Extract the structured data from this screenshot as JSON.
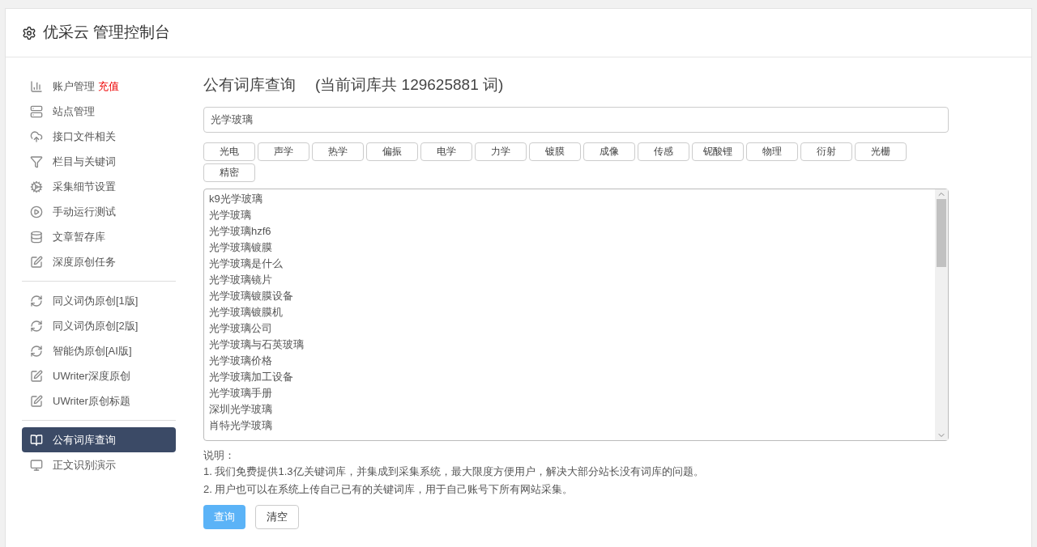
{
  "header": {
    "title": "优采云 管理控制台"
  },
  "sidebar": {
    "groups": [
      [
        {
          "label": "账户管理",
          "badge": "充值",
          "selected": false
        },
        {
          "label": "站点管理",
          "selected": false
        },
        {
          "label": "接口文件相关",
          "selected": false
        },
        {
          "label": "栏目与关键词",
          "selected": false
        },
        {
          "label": "采集细节设置",
          "selected": false
        },
        {
          "label": "手动运行测试",
          "selected": false
        },
        {
          "label": "文章暂存库",
          "selected": false
        },
        {
          "label": "深度原创任务",
          "selected": false
        }
      ],
      [
        {
          "label": "同义词伪原创[1版]",
          "selected": false
        },
        {
          "label": "同义词伪原创[2版]",
          "selected": false
        },
        {
          "label": "智能伪原创[AI版]",
          "selected": false
        },
        {
          "label": "UWriter深度原创",
          "selected": false
        },
        {
          "label": "UWriter原创标题",
          "selected": false
        }
      ],
      [
        {
          "label": "公有词库查询",
          "selected": true
        },
        {
          "label": "正文识别演示",
          "selected": false
        }
      ]
    ]
  },
  "main": {
    "title": "公有词库查询",
    "count": "(当前词库共 129625881 词)",
    "search": {
      "value": "光学玻璃"
    },
    "tags": [
      "光电",
      "声学",
      "热学",
      "偏振",
      "电学",
      "力学",
      "镀膜",
      "成像",
      "传感",
      "铌酸锂",
      "物理",
      "衍射",
      "光栅",
      "精密"
    ],
    "results": [
      "k9光学玻璃",
      "光学玻璃",
      "光学玻璃hzf6",
      "光学玻璃镀膜",
      "光学玻璃是什么",
      "光学玻璃镜片",
      "光学玻璃镀膜设备",
      "光学玻璃镀膜机",
      "光学玻璃公司",
      "光学玻璃与石英玻璃",
      "光学玻璃价格",
      "光学玻璃加工设备",
      "光学玻璃手册",
      "深圳光学玻璃",
      "肖特光学玻璃"
    ],
    "notes_title": "说明：",
    "notes": [
      "1. 我们免费提供1.3亿关键词库，并集成到采集系统，最大限度方便用户，解决大部分站长没有词库的问题。",
      "2. 用户也可以在系统上传自己已有的关键词库，用于自己账号下所有网站采集。"
    ],
    "buttons": [
      {
        "label": "查询",
        "kind": "primary"
      },
      {
        "label": "清空",
        "kind": "default"
      }
    ]
  }
}
